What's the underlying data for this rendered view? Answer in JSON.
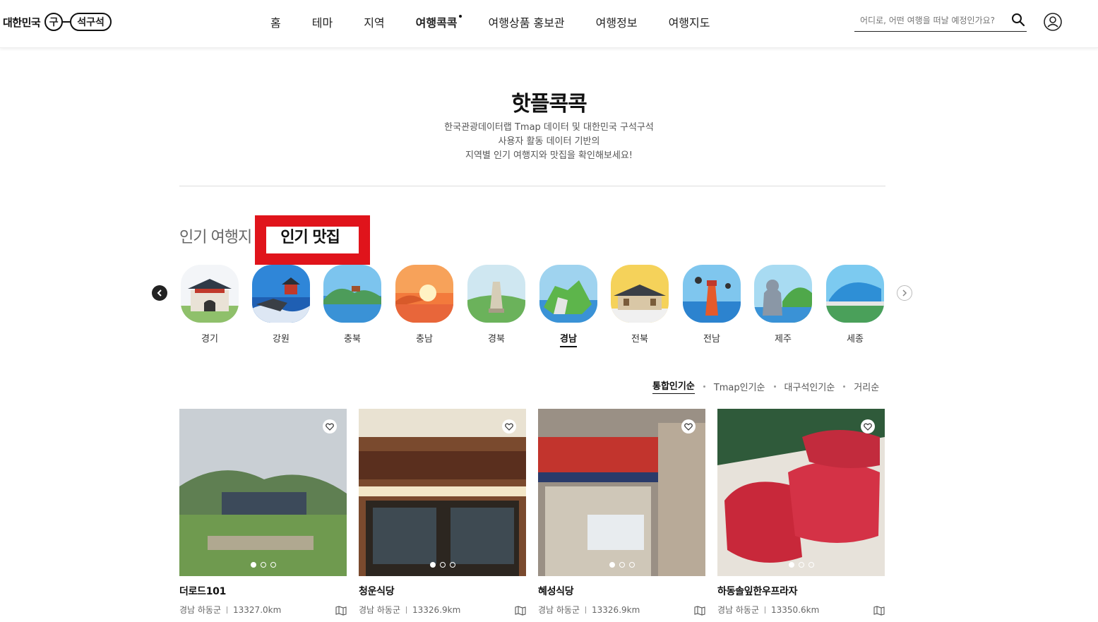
{
  "header": {
    "logo_text": "대한민국",
    "logo_mark_circle": "구",
    "logo_mark_pill": "석구석",
    "nav": [
      "홈",
      "테마",
      "지역",
      "여행콕콕",
      "여행상품 홍보관",
      "여행정보",
      "여행지도"
    ],
    "active_nav": "여행콕콕",
    "search_placeholder": "어디로, 어떤 여행을 떠날 예정인가요?",
    "icons": [
      "search-icon",
      "user-icon"
    ]
  },
  "intro": {
    "title": "핫플콕콕",
    "line1": "한국관광데이터랩 Tmap 데이터 및 대한민국 구석구석",
    "line2": "사용자 활동 데이터 기반의",
    "line3": "지역별 인기 여행지와 맛집을 확인해보세요!"
  },
  "tabs": {
    "inactive": "인기 여행지",
    "active": "인기 맛집"
  },
  "highlight_color": "#e0141b",
  "regions": [
    {
      "label": "경기",
      "selected": false
    },
    {
      "label": "강원",
      "selected": false
    },
    {
      "label": "충북",
      "selected": false
    },
    {
      "label": "충남",
      "selected": false
    },
    {
      "label": "경북",
      "selected": false
    },
    {
      "label": "경남",
      "selected": true
    },
    {
      "label": "전북",
      "selected": false
    },
    {
      "label": "전남",
      "selected": false
    },
    {
      "label": "제주",
      "selected": false
    },
    {
      "label": "세종",
      "selected": false
    }
  ],
  "sort": {
    "options": [
      "통합인기순",
      "Tmap인기순",
      "대구석인기순",
      "거리순"
    ],
    "active": "통합인기순"
  },
  "cards": [
    {
      "name": "더로드101",
      "region": "경남 하동군",
      "distance": "13327.0km"
    },
    {
      "name": "청운식당",
      "region": "경남 하동군",
      "distance": "13326.9km"
    },
    {
      "name": "혜성식당",
      "region": "경남 하동군",
      "distance": "13326.9km"
    },
    {
      "name": "하동솔잎한우프라자",
      "region": "경남 하동군",
      "distance": "13350.6km"
    }
  ]
}
